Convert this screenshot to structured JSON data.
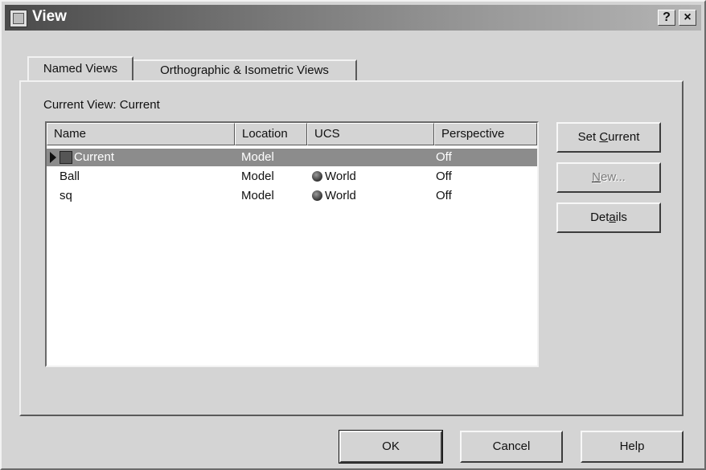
{
  "window": {
    "title": "View"
  },
  "titlebar_buttons": {
    "help": "?",
    "close": "×"
  },
  "tabs": [
    {
      "label": "Named Views",
      "active": true
    },
    {
      "label": "Orthographic & Isometric Views",
      "active": false
    }
  ],
  "current_view": {
    "label": "Current View:",
    "value": "Current"
  },
  "table": {
    "columns": [
      "Name",
      "Location",
      "UCS",
      "Perspective"
    ],
    "rows": [
      {
        "name": "Current",
        "location": "Model",
        "ucs": "",
        "perspective": "Off",
        "selected": true,
        "icon": "view-icon"
      },
      {
        "name": "Ball",
        "location": "Model",
        "ucs": "World",
        "perspective": "Off",
        "selected": false,
        "icon": "globe-icon"
      },
      {
        "name": "sq",
        "location": "Model",
        "ucs": "World",
        "perspective": "Off",
        "selected": false,
        "icon": "globe-icon"
      }
    ]
  },
  "side_buttons": {
    "set_current": {
      "pre": "Set ",
      "key": "C",
      "post": "urrent"
    },
    "new": {
      "pre": "",
      "key": "N",
      "post": "ew..."
    },
    "details": {
      "pre": "Det",
      "key": "a",
      "post": "ils"
    }
  },
  "footer_buttons": {
    "ok": "OK",
    "cancel": "Cancel",
    "help": "Help"
  },
  "colors": {
    "titlebar_dark": "#4a4a4a",
    "selection": "#8c8c8c",
    "face": "#d4d4d4"
  }
}
